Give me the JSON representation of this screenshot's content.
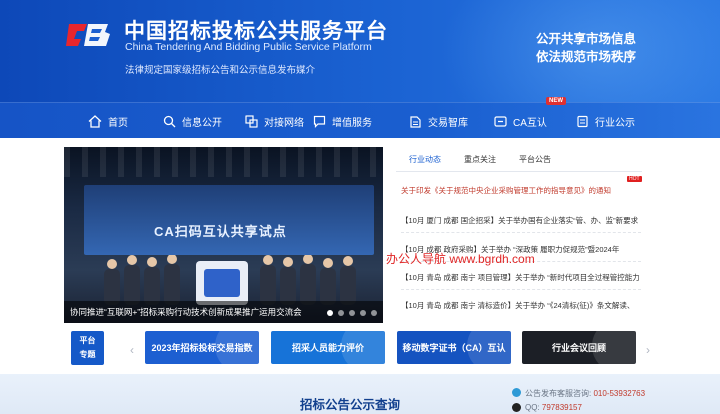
{
  "header": {
    "logo_text": "CB",
    "title_cn": "中国招标投标公共服务平台",
    "title_en": "China Tendering And Bidding Public Service Platform",
    "tagline": "法律规定国家级招标公告和公示信息发布媒介",
    "slogan_line1": "公开共享市场信息",
    "slogan_line2": "依法规范市场秩序"
  },
  "nav": {
    "items": [
      {
        "label": "首页",
        "icon": "home-icon"
      },
      {
        "label": "信息公开",
        "icon": "search-icon"
      },
      {
        "label": "对接网络",
        "icon": "network-icon"
      },
      {
        "label": "增值服务",
        "icon": "chat-icon"
      },
      {
        "label": "交易智库",
        "icon": "book-icon"
      },
      {
        "label": "CA互认",
        "icon": "certificate-icon",
        "badge": "NEW"
      },
      {
        "label": "行业公示",
        "icon": "list-icon"
      }
    ]
  },
  "slider": {
    "screen_text": "CA扫码互认共享试点",
    "caption": "协同推进“互联网+”招标采购行动技术创新成果推广运用交流会",
    "slide_count": 5,
    "active_slide": 1
  },
  "news": {
    "tabs": [
      "行业动态",
      "重点关注",
      "平台公告"
    ],
    "active_tab": 0,
    "headline": "关于印发《关于规范中央企业采购管理工作的指导意见》的通知",
    "headline_badge": "HOT",
    "items": [
      "【10月 厦门 成都 国企招采】关于举办国有企业落实“管、办、监”新要求",
      "【10月 成都 政府采购】关于举办 “深政策 履职力促规范”暨2024年",
      "【10月 青岛 成都 南宁 项目管理】关于举办 “新时代项目全过程管控能力",
      "【10月 青岛 成都 南宁 清标造价】关于举办 “《24清标(征)》条文解读、"
    ]
  },
  "watermark": "办公人导航 www.bgrdh.com",
  "features": {
    "platform_label_1": "平台",
    "platform_label_2": "专题",
    "prev_arrow": "‹",
    "next_arrow": "›",
    "cards": [
      {
        "label": "2023年招标投标交易指数",
        "color": "#1d5fd1"
      },
      {
        "label": "招采人员能力评价",
        "color": "#1773d8"
      },
      {
        "label": "移动数字证书（CA）互认",
        "color": "#1553c0"
      },
      {
        "label": "行业会议回顾",
        "color": "#1c1f26"
      }
    ]
  },
  "footer": {
    "query_title": "招标公告公示查询",
    "hotline_label": "公告发布客服咨询:",
    "hotline_number": "010-53932763",
    "qq_label": "QQ:",
    "qq_number": "797839157"
  }
}
